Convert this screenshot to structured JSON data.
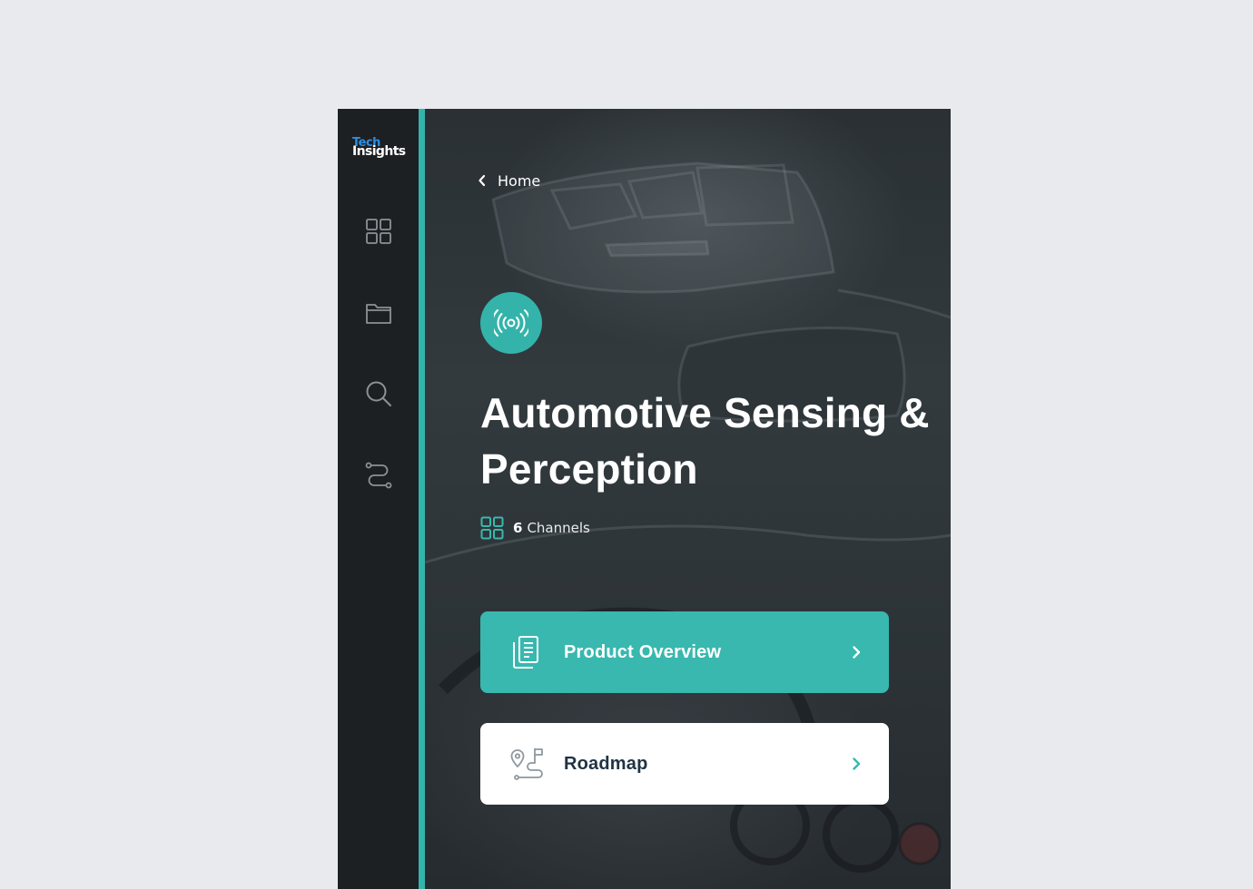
{
  "brand": {
    "logo_line1": "Tech",
    "logo_line2": "Insights",
    "logo_line1_color": "#2d8fe0",
    "accent_color": "#33b3aa"
  },
  "sidebar": {
    "items": [
      {
        "icon": "grid-icon",
        "label": "Dashboard"
      },
      {
        "icon": "folder-icon",
        "label": "Folders"
      },
      {
        "icon": "search-icon",
        "label": "Search"
      },
      {
        "icon": "route-icon",
        "label": "Roadmaps"
      }
    ]
  },
  "breadcrumb": {
    "icon": "chevron-left-icon",
    "label": "Home"
  },
  "topic": {
    "icon": "broadcast-signal-icon",
    "title": "Automotive Sensing & Perception",
    "channels_icon": "grid-icon",
    "channels_count": "6",
    "channels_label": "Channels"
  },
  "cards": [
    {
      "icon": "documents-icon",
      "label": "Product Overview",
      "style": "teal",
      "color": "#38b8af",
      "arrow": "chevron-right-icon"
    },
    {
      "icon": "roadmap-icon",
      "label": "Roadmap",
      "style": "white",
      "color": "#ffffff",
      "arrow": "chevron-right-icon"
    }
  ]
}
